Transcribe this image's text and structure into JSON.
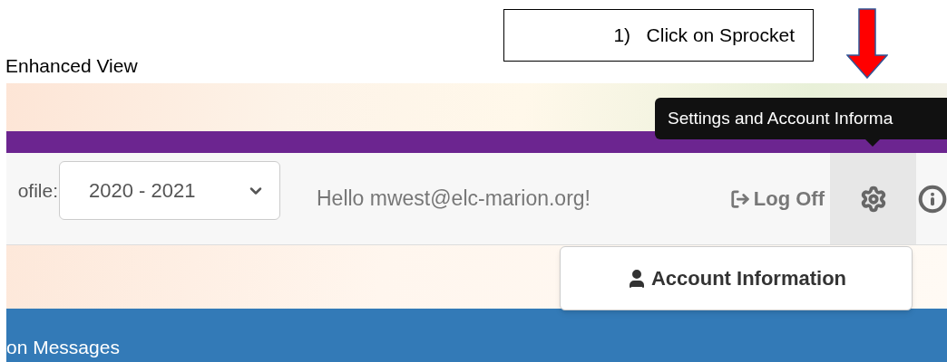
{
  "heading": "Enhanced View",
  "callout": "1)   Click on Sprocket",
  "tooltip": "Settings and Account Informa",
  "toolbar": {
    "profile_label": "ofile:",
    "year_select": {
      "value": "2020 - 2021"
    },
    "greeting": "Hello mwest@elc-marion.org!",
    "log_off": "Log Off"
  },
  "menu": {
    "items": [
      {
        "label": "Account Information"
      }
    ]
  },
  "banner": "on Messages"
}
